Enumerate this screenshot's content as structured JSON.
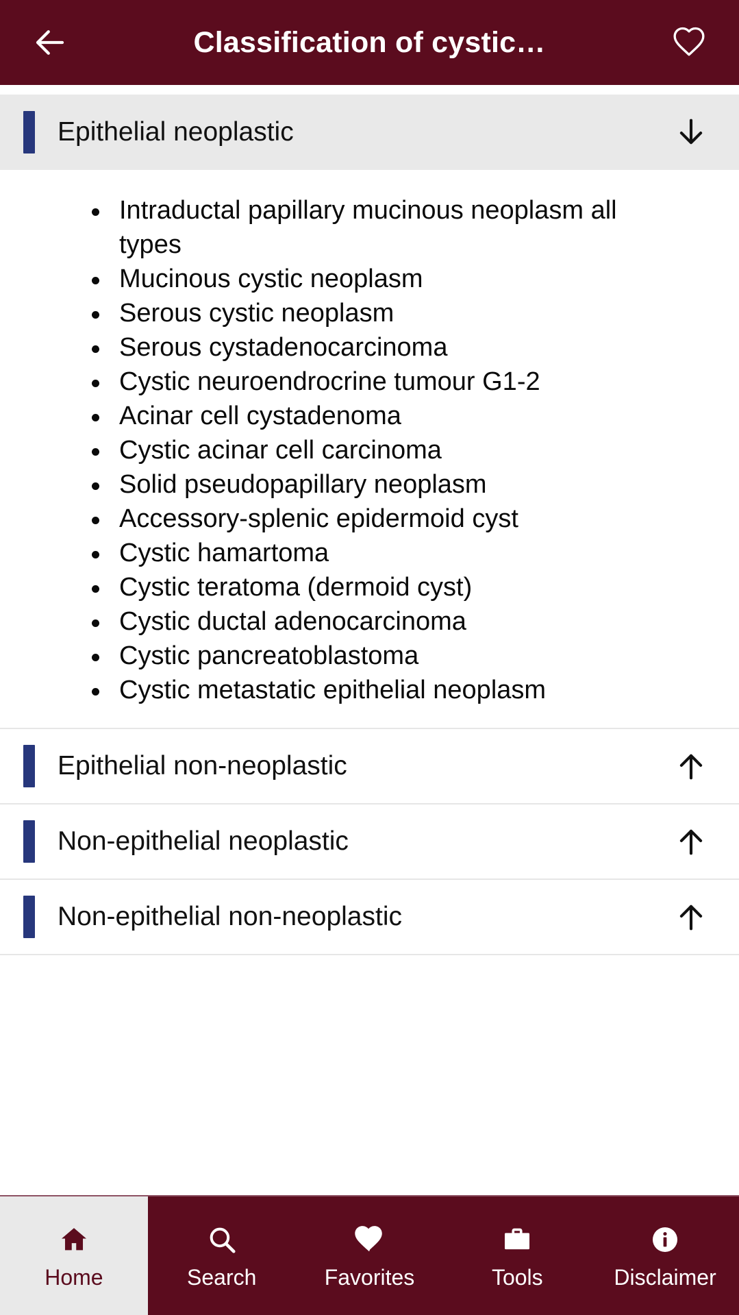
{
  "theme": {
    "primary": "#5b0c1e",
    "accent_bar": "#27377c",
    "expanded_header_bg": "#e9e9e9",
    "text": "#0a0a0a"
  },
  "header": {
    "back_icon": "arrow-left-icon",
    "title": "Classification of cystic…",
    "favorite_icon": "heart-outline-icon"
  },
  "sections": [
    {
      "label": "Epithelial neoplastic",
      "state": "expanded",
      "arrow_icon": "arrow-down-icon",
      "items": [
        "Intraductal papillary mucinous neoplasm all types",
        "Mucinous cystic neoplasm",
        "Serous cystic neoplasm",
        "Serous cystadenocarcinoma",
        "Cystic neuroendrocrine tumour G1-2",
        "Acinar cell cystadenoma",
        "Cystic acinar cell carcinoma",
        "Solid pseudopapillary neoplasm",
        "Accessory-splenic epidermoid cyst",
        "Cystic hamartoma",
        "Cystic teratoma (dermoid cyst)",
        "Cystic ductal adenocarcinoma",
        "Cystic pancreatoblastoma",
        "Cystic metastatic epithelial neoplasm"
      ]
    },
    {
      "label": "Epithelial non-neoplastic",
      "state": "collapsed",
      "arrow_icon": "arrow-up-icon",
      "items": []
    },
    {
      "label": "Non-epithelial neoplastic",
      "state": "collapsed",
      "arrow_icon": "arrow-up-icon",
      "items": []
    },
    {
      "label": "Non-epithelial non-neoplastic",
      "state": "collapsed",
      "arrow_icon": "arrow-up-icon",
      "items": []
    }
  ],
  "bottom_nav": {
    "items": [
      {
        "label": "Home",
        "icon": "home-icon",
        "active": true
      },
      {
        "label": "Search",
        "icon": "search-icon",
        "active": false
      },
      {
        "label": "Favorites",
        "icon": "heart-filled-icon",
        "active": false
      },
      {
        "label": "Tools",
        "icon": "briefcase-icon",
        "active": false
      },
      {
        "label": "Disclaimer",
        "icon": "info-circle-icon",
        "active": false
      }
    ]
  }
}
